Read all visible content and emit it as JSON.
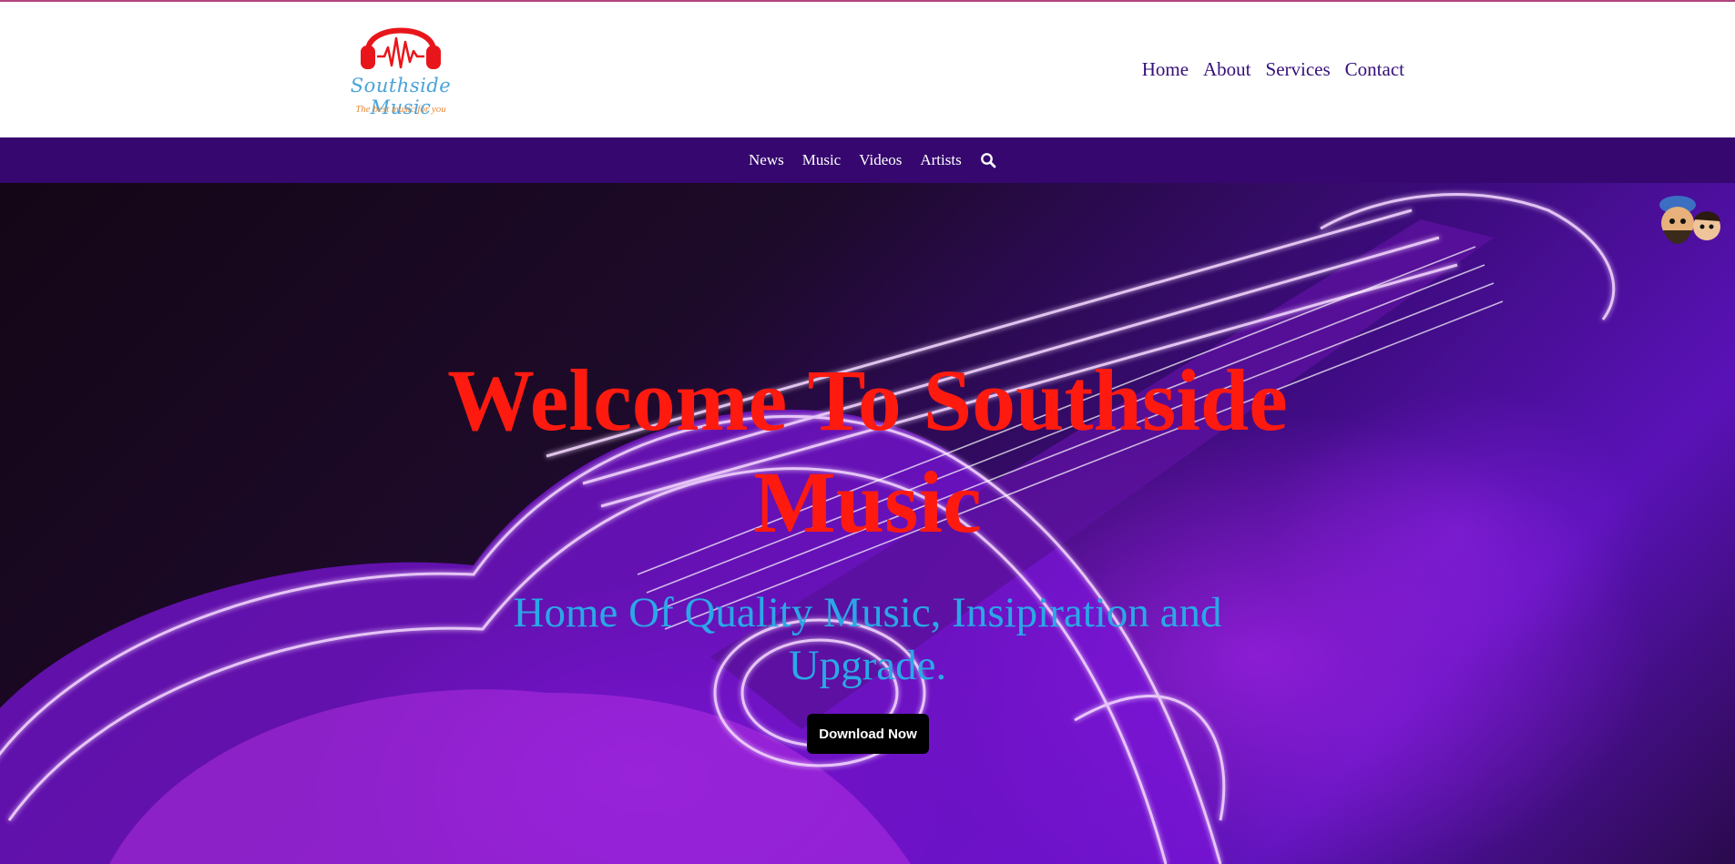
{
  "brand": {
    "name": "Southside Music",
    "tagline": "The best music for you",
    "logo_icon": "headphones-waveform-icon",
    "colors": {
      "logo_red": "#e8161b",
      "logo_blue": "#4aa3d8",
      "tagline_orange": "#e48b3c"
    }
  },
  "main_nav": {
    "items": [
      {
        "label": "Home"
      },
      {
        "label": "About"
      },
      {
        "label": "Services"
      },
      {
        "label": "Contact"
      }
    ],
    "color": "#35107a"
  },
  "sub_nav": {
    "items": [
      {
        "label": "News"
      },
      {
        "label": "Music"
      },
      {
        "label": "Videos"
      },
      {
        "label": "Artists"
      }
    ],
    "search_icon": "search-icon",
    "background": "#35076f"
  },
  "hero": {
    "title": "Welcome To Southside Music",
    "subtitle": "Home Of Quality Music, Insipiration and Upgrade.",
    "cta_label": "Download Now",
    "background_image": "neon-guitar-light-painting",
    "title_color": "#ff1a10",
    "subtitle_color": "#2aa8e6",
    "cta_color": "#000000"
  },
  "accent_line_color": "#b0447e"
}
